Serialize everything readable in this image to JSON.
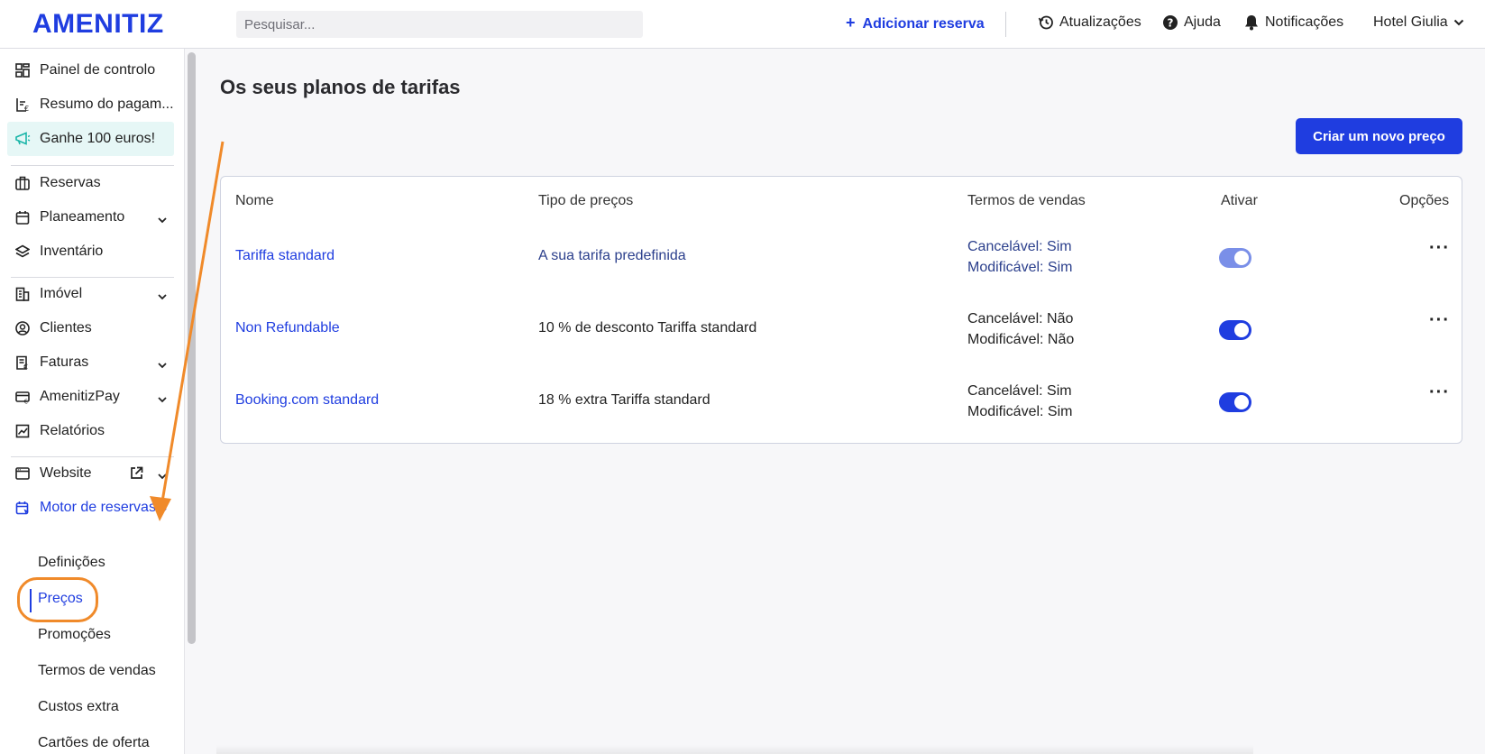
{
  "header": {
    "logo": "AMENITIZ",
    "search_placeholder": "Pesquisar...",
    "add_reservation": "Adicionar reserva",
    "add_plus": "+",
    "updates": "Atualizações",
    "help": "Ajuda",
    "notifications": "Notificações",
    "hotel": "Hotel Giulia"
  },
  "sidebar": {
    "items": [
      {
        "label": "Painel de controlo",
        "icon": "dashboard-icon"
      },
      {
        "label": "Resumo do pagam...",
        "icon": "payment-summary-icon"
      },
      {
        "label": "Ganhe 100 euros!",
        "icon": "megaphone-icon"
      },
      {
        "label": "Reservas",
        "icon": "briefcase-icon"
      },
      {
        "label": "Planeamento",
        "icon": "calendar-icon"
      },
      {
        "label": "Inventário",
        "icon": "layers-icon"
      },
      {
        "label": "Imóvel",
        "icon": "building-icon"
      },
      {
        "label": "Clientes",
        "icon": "clients-icon"
      },
      {
        "label": "Faturas",
        "icon": "invoice-icon"
      },
      {
        "label": "AmenitizPay",
        "icon": "card-icon"
      },
      {
        "label": "Relatórios",
        "icon": "chart-icon"
      },
      {
        "label": "Website",
        "icon": "browser-icon"
      },
      {
        "label": "Motor de reservas",
        "icon": "booking-engine-icon"
      }
    ],
    "subitems": [
      "Definições",
      "Preços",
      "Promoções",
      "Termos de vendas",
      "Custos extra",
      "Cartões de oferta"
    ]
  },
  "main": {
    "title": "Os seus planos de tarifas",
    "new_price_button": "Criar um novo preço",
    "table": {
      "headers": [
        "Nome",
        "Tipo de preços",
        "Termos de vendas",
        "Ativar",
        "Opções"
      ],
      "rows": [
        {
          "name": "Tariffa standard",
          "type": "A sua tarifa predefinida",
          "cancel": "Cancelável: Sim",
          "modify": "Modificável: Sim",
          "active": true,
          "options": "···"
        },
        {
          "name": "Non Refundable",
          "type": "10 % de desconto Tariffa standard",
          "cancel": "Cancelável: Não",
          "modify": "Modificável: Não",
          "active": true,
          "options": "···"
        },
        {
          "name": "Booking.com standard",
          "type": "18 % extra Tariffa standard",
          "cancel": "Cancelável: Sim",
          "modify": "Modificável: Sim",
          "active": true,
          "options": "···"
        }
      ]
    }
  },
  "colors": {
    "accent": "#1f3de0",
    "annotation": "#f08a2a"
  }
}
